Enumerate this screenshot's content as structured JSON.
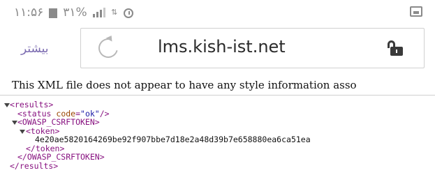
{
  "status_bar": {
    "time": "۱۱:۵۶",
    "battery": "۳۱%"
  },
  "browser": {
    "menu_more": "بیشتر",
    "url": "lms.kish-ist.net"
  },
  "xml_viewer": {
    "banner": "This XML file does not appear to have any style information asso",
    "lines": {
      "results_open": "<results>",
      "status_tag_open": "<status ",
      "status_attr_name": "code",
      "status_attr_eq": "=",
      "status_attr_value": "\"ok\"",
      "status_tag_close": "/>",
      "owasp_open": "<OWASP_CSRFTOKEN>",
      "token_open": "<token>",
      "token_value": "4e20ae5820164269be92f907bbe7d18e2a48d39b7e658880ea6ca51ea",
      "token_close": "</token>",
      "owasp_close": "</OWASP_CSRFTOKEN>",
      "results_close": "</results>"
    }
  }
}
